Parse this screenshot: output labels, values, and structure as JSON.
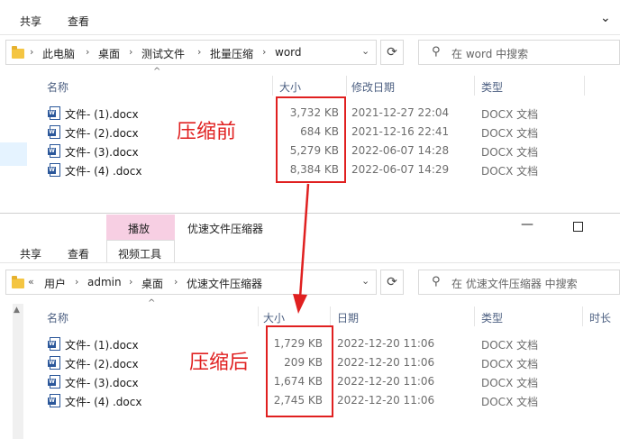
{
  "top_window": {
    "ribbon_tabs": [
      "共享",
      "查看"
    ],
    "breadcrumb": [
      "此电脑",
      "桌面",
      "测试文件",
      "批量压缩",
      "word"
    ],
    "search_placeholder": "在 word 中搜索",
    "columns": {
      "name": "名称",
      "size": "大小",
      "modified": "修改日期",
      "type": "类型"
    },
    "files": [
      {
        "name": "文件- (1).docx",
        "size": "3,732 KB",
        "date": "2021-12-27 22:04",
        "type": "DOCX 文档"
      },
      {
        "name": "文件- (2).docx",
        "size": "684 KB",
        "date": "2021-12-16 22:41",
        "type": "DOCX 文档"
      },
      {
        "name": "文件- (3).docx",
        "size": "5,279 KB",
        "date": "2022-06-07 14:28",
        "type": "DOCX 文档"
      },
      {
        "name": "文件- (4) .docx",
        "size": "8,384 KB",
        "date": "2022-06-07 14:29",
        "type": "DOCX 文档"
      }
    ],
    "annotation": "压缩前"
  },
  "bottom_window": {
    "context_tab": "播放",
    "window_title": "优速文件压缩器",
    "ribbon_tabs": [
      "共享",
      "查看",
      "视频工具"
    ],
    "breadcrumb_prefix": "«",
    "breadcrumb": [
      "用户",
      "admin",
      "桌面",
      "优速文件压缩器"
    ],
    "search_placeholder": "在 优速文件压缩器 中搜索",
    "columns": {
      "name": "名称",
      "size": "大小",
      "date": "日期",
      "type": "类型",
      "duration": "时长"
    },
    "files": [
      {
        "name": "文件- (1).docx",
        "size": "1,729 KB",
        "date": "2022-12-20 11:06",
        "type": "DOCX 文档"
      },
      {
        "name": "文件- (2).docx",
        "size": "209 KB",
        "date": "2022-12-20 11:06",
        "type": "DOCX 文档"
      },
      {
        "name": "文件- (3).docx",
        "size": "1,674 KB",
        "date": "2022-12-20 11:06",
        "type": "DOCX 文档"
      },
      {
        "name": "文件- (4) .docx",
        "size": "2,745 KB",
        "date": "2022-12-20 11:06",
        "type": "DOCX 文档"
      }
    ],
    "annotation": "压缩后"
  },
  "colors": {
    "annotation_red": "#e02020",
    "context_tab_bg": "#f7cfe3",
    "folder_yellow": "#f4c542"
  }
}
